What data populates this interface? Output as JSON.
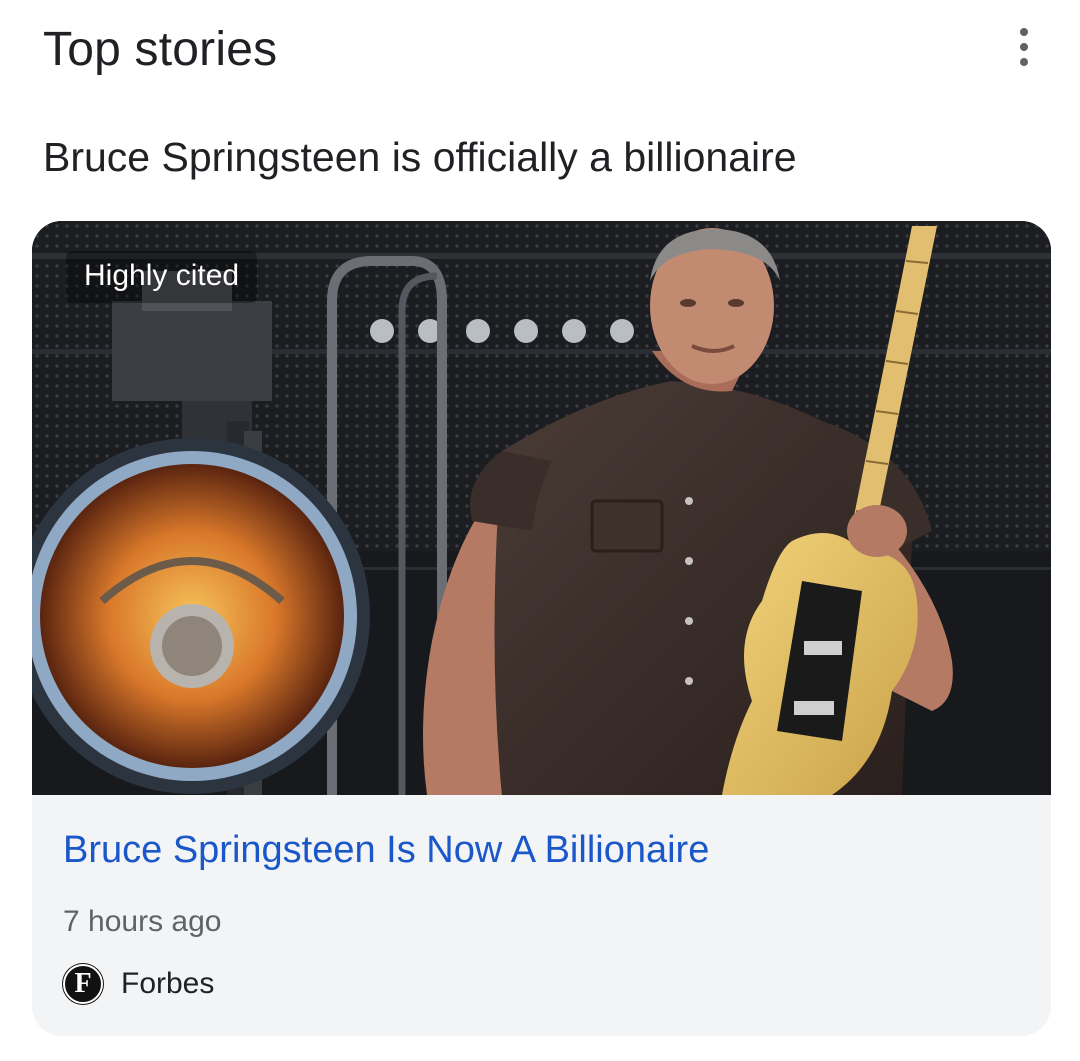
{
  "header": {
    "title": "Top stories",
    "more_icon": "more-vert-icon"
  },
  "story": {
    "headline": "Bruce Springsteen is officially a billionaire"
  },
  "card": {
    "badge": "Highly cited",
    "image_subject": "guitarist-on-stage",
    "article_title": "Bruce Springsteen Is Now A Billionaire",
    "timestamp": "7 hours ago",
    "source": {
      "name": "Forbes",
      "logo_letter": "F"
    }
  },
  "colors": {
    "link": "#1a57c9",
    "card_bg": "#f3f4f6",
    "text": "#202124",
    "secondary_text": "#5f6368"
  }
}
